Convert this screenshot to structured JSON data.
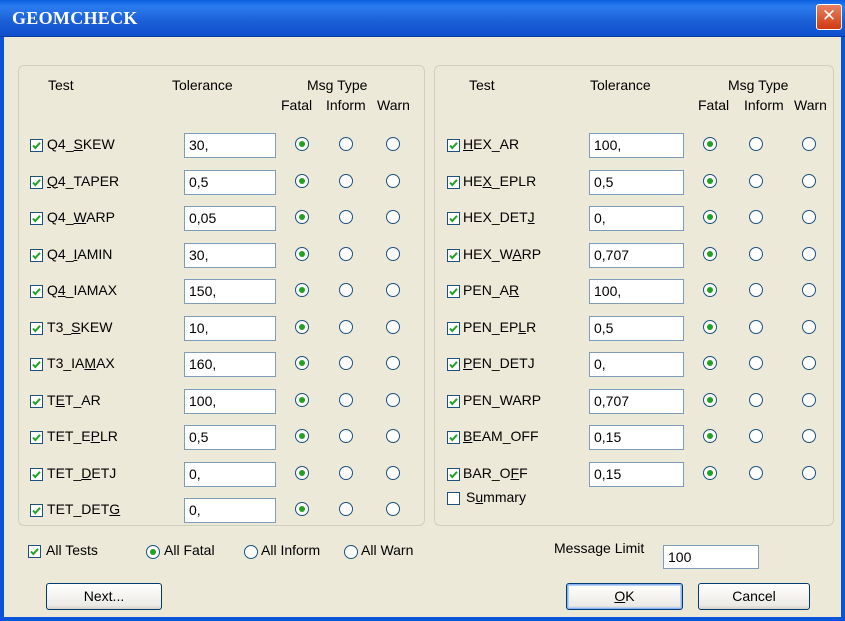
{
  "window": {
    "title": "GEOMCHECK",
    "close_glyph": "✕"
  },
  "headers": {
    "test": "Test",
    "tolerance": "Tolerance",
    "msg_type": "Msg Type",
    "fatal": "Fatal",
    "inform": "Inform",
    "warn": "Warn"
  },
  "left_tests": [
    {
      "name": "Q4_SKEW",
      "ul": 3,
      "value": "30,",
      "checked": true,
      "msg": "fatal"
    },
    {
      "name": "Q4_TAPER",
      "ul": 0,
      "value": "0,5",
      "checked": true,
      "msg": "fatal"
    },
    {
      "name": "Q4_WARP",
      "ul": 3,
      "value": "0,05",
      "checked": true,
      "msg": "fatal"
    },
    {
      "name": "Q4_IAMIN",
      "ul": 3,
      "value": "30,",
      "checked": true,
      "msg": "fatal"
    },
    {
      "name": "Q4_IAMAX",
      "ul": 1,
      "value": "150,",
      "checked": true,
      "msg": "fatal"
    },
    {
      "name": "T3_SKEW",
      "ul": 3,
      "value": "10,",
      "checked": true,
      "msg": "fatal"
    },
    {
      "name": "T3_IAMAX",
      "ul": 5,
      "value": "160,",
      "checked": true,
      "msg": "fatal"
    },
    {
      "name": "TET_AR",
      "ul": 1,
      "value": "100,",
      "checked": true,
      "msg": "fatal"
    },
    {
      "name": "TET_EPLR",
      "ul": 5,
      "value": "0,5",
      "checked": true,
      "msg": "fatal"
    },
    {
      "name": "TET_DETJ",
      "ul": 4,
      "value": "0,",
      "checked": true,
      "msg": "fatal"
    },
    {
      "name": "TET_DETG",
      "ul": 7,
      "value": "0,",
      "checked": true,
      "msg": "fatal"
    }
  ],
  "right_tests": [
    {
      "name": "HEX_AR",
      "ul": 0,
      "value": "100,",
      "checked": true,
      "msg": "fatal"
    },
    {
      "name": "HEX_EPLR",
      "ul": 2,
      "value": "0,5",
      "checked": true,
      "msg": "fatal"
    },
    {
      "name": "HEX_DETJ",
      "ul": 7,
      "value": "0,",
      "checked": true,
      "msg": "fatal"
    },
    {
      "name": "HEX_WARP",
      "ul": 5,
      "value": "0,707",
      "checked": true,
      "msg": "fatal"
    },
    {
      "name": "PEN_AR",
      "ul": 5,
      "value": "100,",
      "checked": true,
      "msg": "fatal"
    },
    {
      "name": "PEN_EPLR",
      "ul": 6,
      "value": "0,5",
      "checked": true,
      "msg": "fatal"
    },
    {
      "name": "PEN_DETJ",
      "ul": 0,
      "value": "0,",
      "checked": true,
      "msg": "fatal"
    },
    {
      "name": "PEN_WARP",
      "ul": -1,
      "value": "0,707",
      "checked": true,
      "msg": "fatal"
    },
    {
      "name": "BEAM_OFF",
      "ul": 0,
      "value": "0,15",
      "checked": true,
      "msg": "fatal"
    },
    {
      "name": "BAR_OFF",
      "ul": 5,
      "value": "0,15",
      "checked": true,
      "msg": "fatal"
    }
  ],
  "summary": {
    "label": "Summary",
    "ul": 1,
    "checked": false
  },
  "bottom": {
    "all_tests": {
      "label": "All Tests",
      "checked": true
    },
    "all_fatal": "All Fatal",
    "all_inform": "All Inform",
    "all_warn": "All Warn",
    "selected": "all_fatal",
    "message_limit_label": "Message Limit",
    "message_limit_value": "100"
  },
  "buttons": {
    "next": "Next...",
    "ok": "OK",
    "ok_ul": 0,
    "cancel": "Cancel"
  },
  "colors": {
    "titlebar": "#0a5fe0",
    "dialog_bg": "#ece9d8",
    "radio_dot": "#21a121",
    "close": "#e05a2c"
  }
}
